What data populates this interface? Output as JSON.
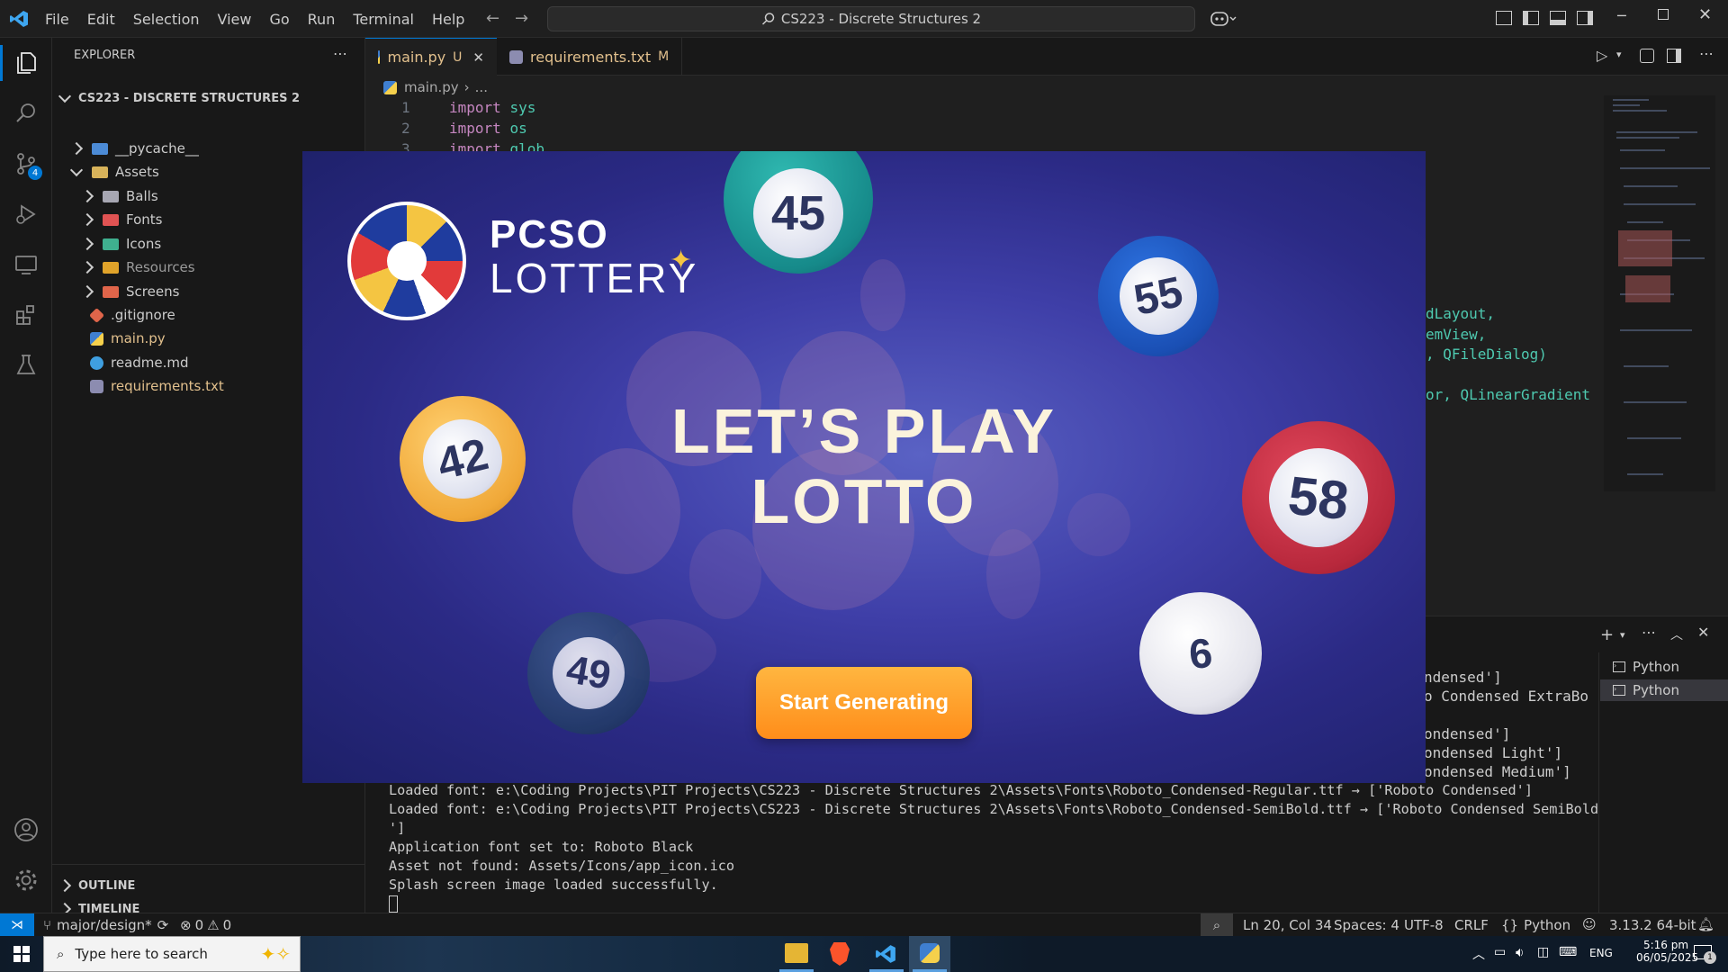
{
  "titlebar": {
    "menu": [
      "File",
      "Edit",
      "Selection",
      "View",
      "Go",
      "Run",
      "Terminal",
      "Help"
    ],
    "search": "CS223 - Discrete Structures 2"
  },
  "activity": {
    "scm_badge": "4"
  },
  "sidebar": {
    "header": "EXPLORER",
    "root": "CS223 - DISCRETE STRUCTURES 2",
    "items": [
      {
        "label": "__pycache__",
        "kind": "folder",
        "color": "#4c8bd6"
      },
      {
        "label": "Assets",
        "kind": "folder-open",
        "color": "#d8b35a"
      },
      {
        "label": "Balls",
        "kind": "folder",
        "color": "#a7a7b3"
      },
      {
        "label": "Fonts",
        "kind": "folder",
        "color": "#e05353"
      },
      {
        "label": "Icons",
        "kind": "folder",
        "color": "#3fb08f"
      },
      {
        "label": "Resources",
        "kind": "folder",
        "color": "#e0a32a"
      },
      {
        "label": "Screens",
        "kind": "folder",
        "color": "#e0654a"
      },
      {
        "label": ".gitignore",
        "kind": "file",
        "color": "#e0654a"
      },
      {
        "label": "main.py",
        "kind": "file",
        "color": "#3f7fd0"
      },
      {
        "label": "readme.md",
        "kind": "file",
        "color": "#3f9fe0"
      },
      {
        "label": "requirements.txt",
        "kind": "file",
        "color": "#a0a0c0"
      }
    ],
    "outline": "OUTLINE",
    "timeline": "TIMELINE"
  },
  "tabs": [
    {
      "label": "main.py",
      "badge": "U"
    },
    {
      "label": "requirements.txt",
      "badge": "M"
    }
  ],
  "breadcrumb": {
    "file": "main.py",
    "rest": "..."
  },
  "code": {
    "lines": [
      {
        "n": "1",
        "kw": "import",
        "mod": "sys"
      },
      {
        "n": "2",
        "kw": "import",
        "mod": "os"
      },
      {
        "n": "3",
        "kw": "import",
        "mod": "glob"
      }
    ],
    "fragments": [
      "dLayout,",
      "emView,",
      ", QFileDialog)",
      "or, QLinearGradient"
    ]
  },
  "terminal": {
    "partial": [
      "ndensed']",
      "o Condensed ExtraBo",
      "ondensed']",
      "ondensed Light']",
      "ondensed Medium']"
    ],
    "lines": [
      "Loaded font: e:\\Coding Projects\\PIT Projects\\CS223 - Discrete Structures 2\\Assets\\Fonts\\Roboto_Condensed-Regular.ttf → ['Roboto Condensed']",
      "Loaded font: e:\\Coding Projects\\PIT Projects\\CS223 - Discrete Structures 2\\Assets\\Fonts\\Roboto_Condensed-SemiBold.ttf → ['Roboto Condensed SemiBold",
      "']",
      "Application font set to: Roboto Black",
      "Asset not found: Assets/Icons/app_icon.ico",
      "Splash screen image loaded successfully."
    ],
    "sessions": [
      "Python",
      "Python"
    ]
  },
  "status": {
    "branch": "major/design*",
    "errors": "0",
    "warnings": "0",
    "position": "Ln 20, Col 34",
    "spaces": "Spaces: 4",
    "encoding": "UTF-8",
    "eol": "CRLF",
    "language": "Python",
    "interpreter": "3.13.2 64-bit"
  },
  "splash": {
    "brand_top": "PCSO",
    "brand_bottom": "LOTTERY",
    "headline1": "LET’S PLAY",
    "headline2": "LOTTO",
    "button": "Start Generating",
    "balls": [
      "45",
      "55",
      "42",
      "58",
      "49",
      "6"
    ]
  },
  "taskbar": {
    "search_placeholder": "Type here to search",
    "lang": "ENG",
    "time": "5:16 pm",
    "date": "06/05/2025",
    "notif": "1"
  }
}
